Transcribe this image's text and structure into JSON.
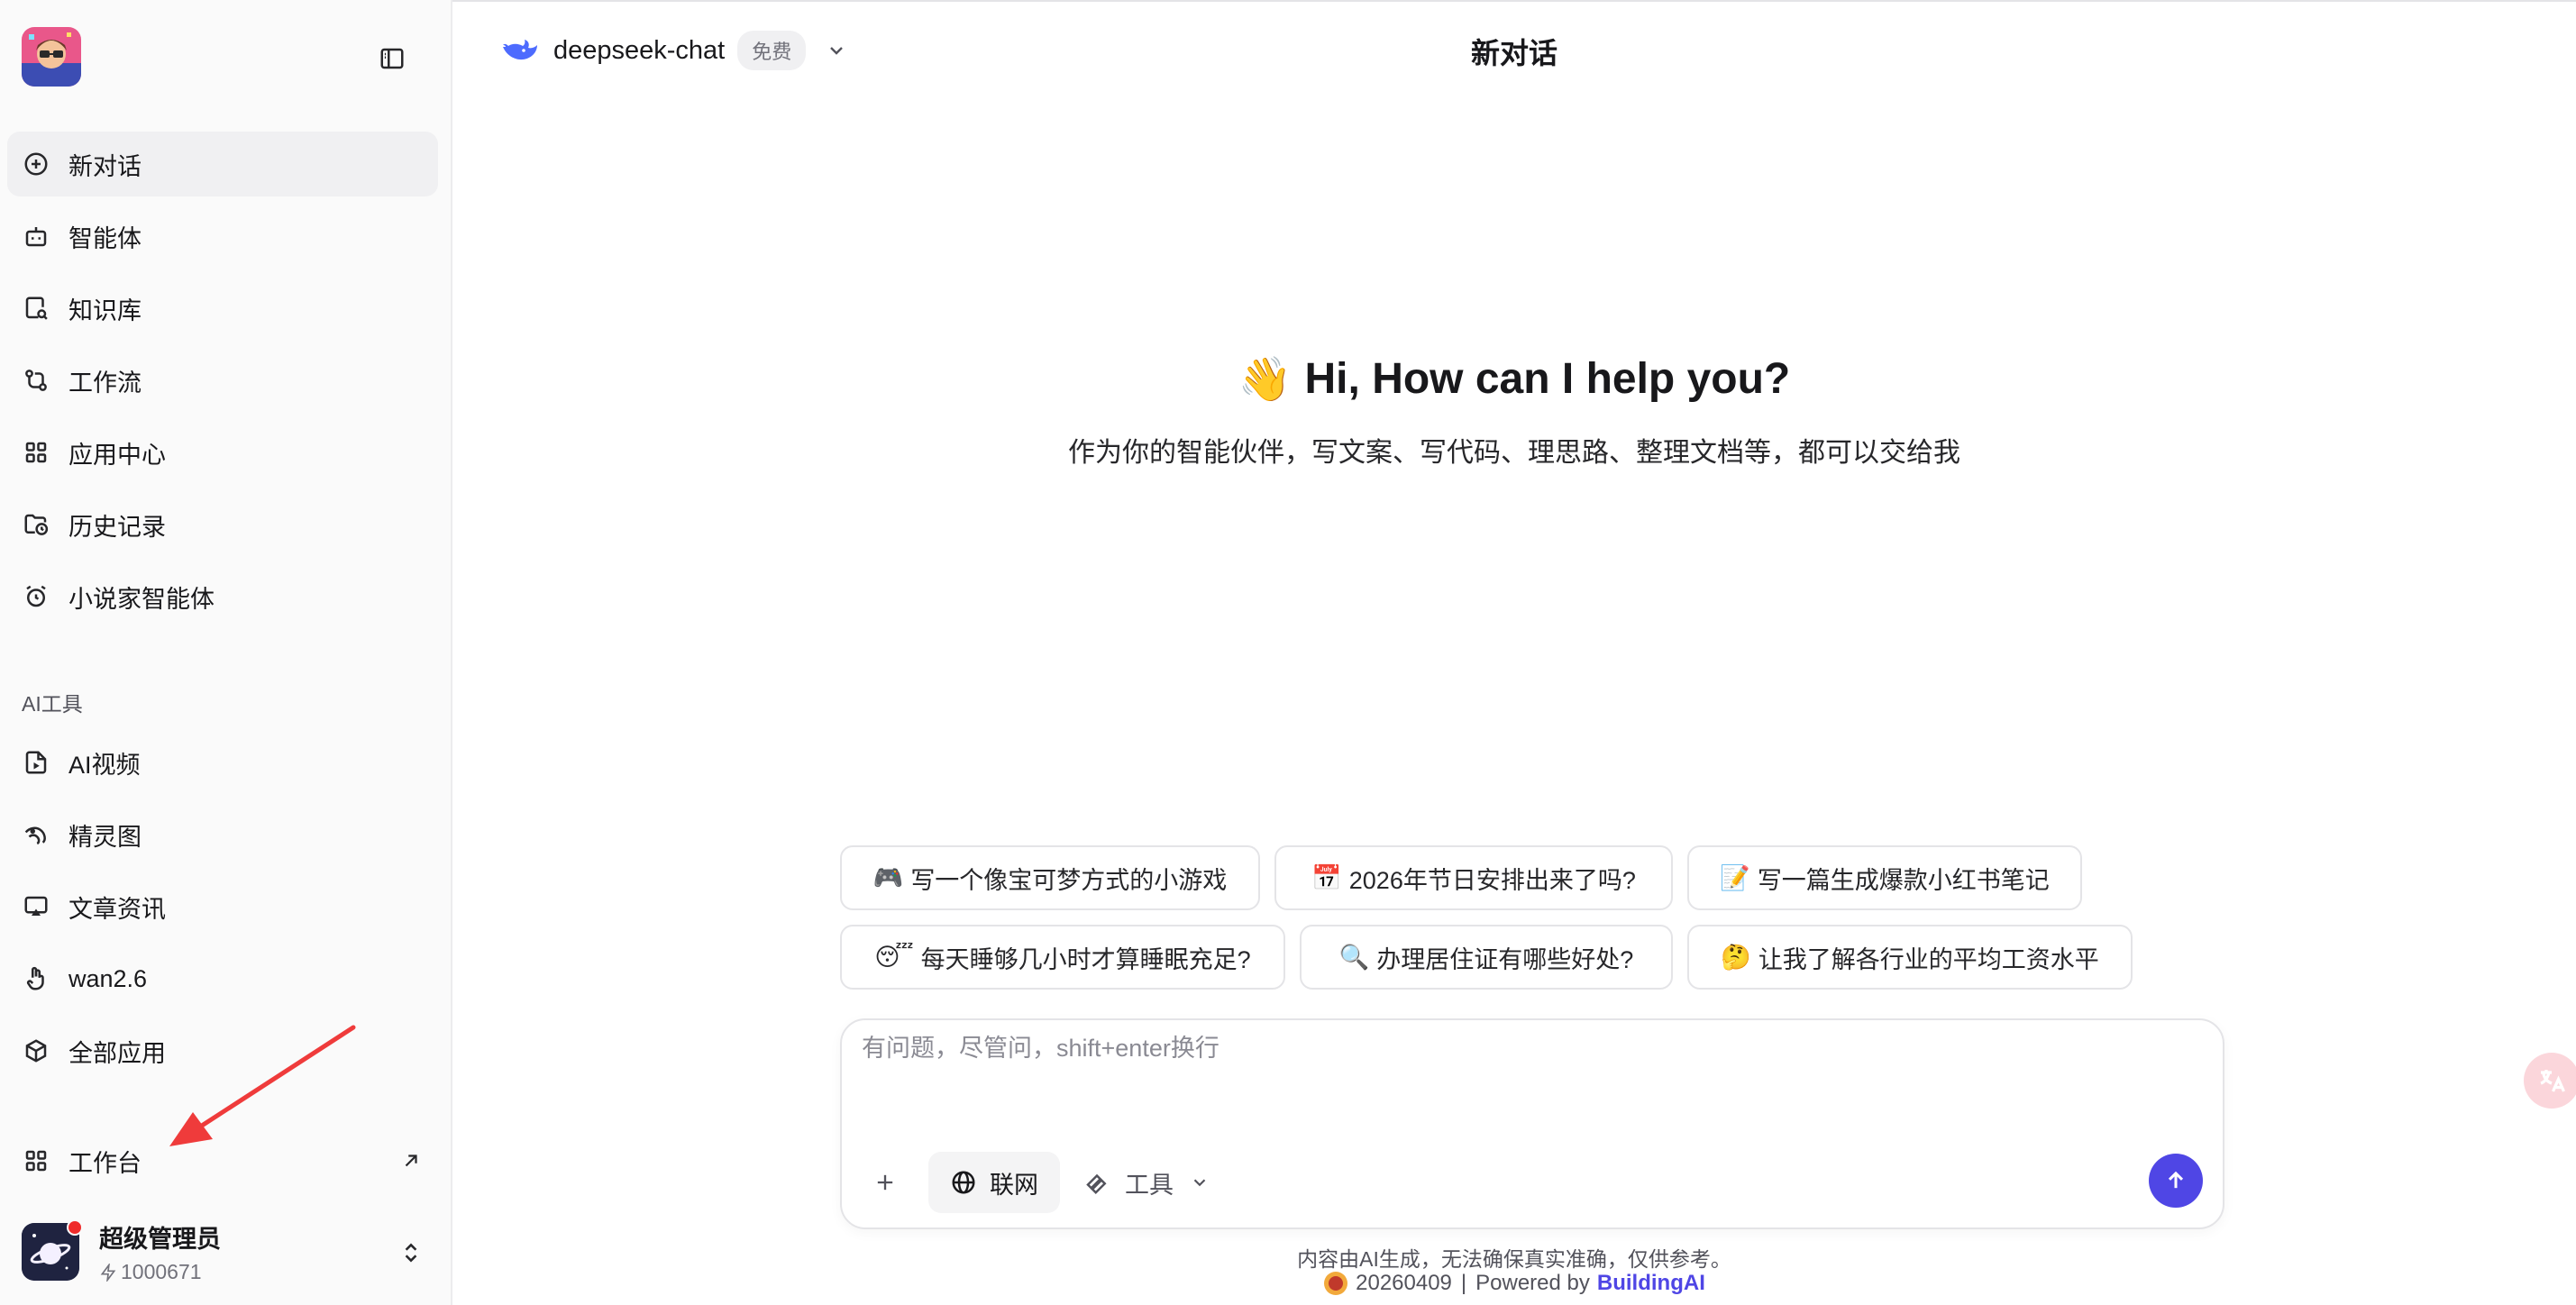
{
  "sidebar": {
    "nav": [
      {
        "label": "新对话",
        "icon": "new-chat-icon"
      },
      {
        "label": "智能体",
        "icon": "robot-icon"
      },
      {
        "label": "知识库",
        "icon": "knowledge-search-icon"
      },
      {
        "label": "工作流",
        "icon": "workflow-icon"
      },
      {
        "label": "应用中心",
        "icon": "apps-grid-icon"
      },
      {
        "label": "历史记录",
        "icon": "history-folder-icon"
      },
      {
        "label": "小说家智能体",
        "icon": "alarm-clock-icon"
      }
    ],
    "section_label": "AI工具",
    "tools": [
      {
        "label": "AI视频",
        "icon": "video-file-icon"
      },
      {
        "label": "精灵图",
        "icon": "sprite-icon"
      },
      {
        "label": "文章资讯",
        "icon": "cast-screen-icon"
      },
      {
        "label": "wan2.6",
        "icon": "hand-icon"
      },
      {
        "label": "全部应用",
        "icon": "cube-icon"
      }
    ],
    "workbench_label": "工作台",
    "user": {
      "name": "超级管理员",
      "points": "1000671"
    }
  },
  "header": {
    "model_name": "deepseek-chat",
    "model_badge": "免费",
    "title": "新对话"
  },
  "hero": {
    "emoji": "👋",
    "title": "Hi, How can I help you?",
    "subtitle": "作为你的智能伙伴，写文案、写代码、理思路、整理文档等，都可以交给我"
  },
  "suggestions": [
    {
      "emoji": "🎮",
      "text": "写一个像宝可梦方式的小游戏"
    },
    {
      "emoji": "📅",
      "text": "2026年节日安排出来了吗?"
    },
    {
      "emoji": "📝",
      "text": "写一篇生成爆款小红书笔记"
    },
    {
      "emoji": "😴",
      "text": "每天睡够几小时才算睡眠充足?"
    },
    {
      "emoji": "🔍",
      "text": "办理居住证有哪些好处?"
    },
    {
      "emoji": "🤔",
      "text": "让我了解各行业的平均工资水平"
    }
  ],
  "composer": {
    "placeholder": "有问题，尽管问，shift+enter换行",
    "web_label": "联网",
    "tools_label": "工具"
  },
  "footer": {
    "disclaimer": "内容由AI生成，无法确保真实准确，仅供参考。",
    "version": "20260409",
    "sep": "|",
    "powered_by": "Powered by",
    "brand": "BuildingAI"
  }
}
